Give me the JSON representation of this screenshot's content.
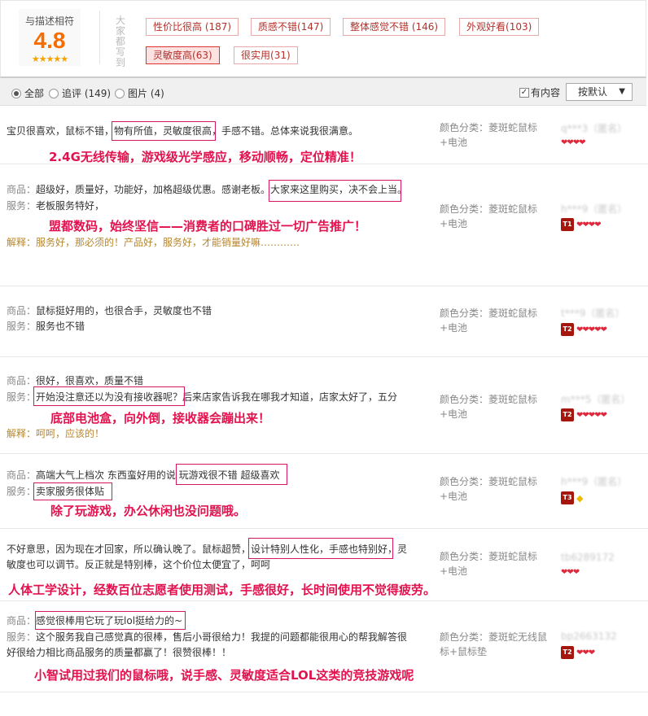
{
  "summary": {
    "score_title": "与描述相符",
    "score": "4.8",
    "stars": "★★★★★",
    "everyone_says": "大家都写到",
    "tags": [
      {
        "label": "性价比很高",
        "count": "(187)"
      },
      {
        "label": "质感不错",
        "count": "(147)"
      },
      {
        "label": "整体感觉不错",
        "count": "(146)"
      },
      {
        "label": "外观好看",
        "count": "(103)"
      },
      {
        "label": "灵敏度高",
        "count": "(63)"
      },
      {
        "label": "很实用",
        "count": "(31)"
      }
    ]
  },
  "filter": {
    "all": "全部",
    "append": "追评 (149)",
    "pics": "图片 (4)",
    "has_content": "有内容",
    "sort": "按默认",
    "caret": "▼"
  },
  "sku_label": "颜色分类：",
  "reviews": [
    {
      "content": "宝贝很喜欢，鼠标不错，物有所值，灵敏度很高，手感不错。总体来说我很满意。",
      "promo": "2.4G无线传输，游戏级光学感应，移动顺畅，定位精准！",
      "sku1": "菱斑蛇鼠标",
      "sku2": "+电池",
      "user": "q***3（匿名）",
      "level": "",
      "hearts": "❤❤❤❤"
    },
    {
      "c_label": "商品：",
      "content": "超级好，质量好，功能好，加格超级优惠。感谢老板。大家来这里购买，决不会上当。",
      "s_label": "服务：",
      "service": "老板服务特好，",
      "promo": "盟都数码，始终坚信——消费者的口碑胜过一切广告推广！",
      "e_label": "解释：",
      "explain": "服务好，那必须的！产品好，服务好，才能销量好嘛…………",
      "sku1": "菱斑蛇鼠标",
      "sku2": "+电池",
      "user": "h***9（匿名）",
      "level": "T1",
      "hearts": "❤❤❤❤"
    },
    {
      "c_label": "商品：",
      "content": "鼠标挺好用的，也很合手，灵敏度也不错",
      "s_label": "服务：",
      "service": "服务也不错",
      "sku1": "菱斑蛇鼠标",
      "sku2": "+电池",
      "user": "t***9（匿名）",
      "level": "T2",
      "hearts": "❤❤❤❤❤"
    },
    {
      "c_label": "商品：",
      "content": "很好，很喜欢，质量不错",
      "s_label": "服务：",
      "service": "开始没注意还以为没有接收器呢？后来店家告诉我在哪我才知道，店家太好了，五分",
      "promo": "底部电池盒，向外倒，接收器会蹦出来！",
      "e_label": "解释：",
      "explain": "呵呵，应该的！",
      "sku1": "菱斑蛇鼠标",
      "sku2": "+电池",
      "user": "m***5（匿名）",
      "level": "T2",
      "hearts": "❤❤❤❤❤"
    },
    {
      "c_label": "商品：",
      "content": "高端大气上档次 东西蛮好用的说 玩游戏很不错 超级喜欢",
      "s_label": "服务：",
      "service": "卖家服务很体贴",
      "promo": "除了玩游戏，办公休闲也没问题哦。",
      "sku1": "菱斑蛇鼠标",
      "sku2": "+电池",
      "user": "h***9（匿名）",
      "level": "T3",
      "hearts": "◆"
    },
    {
      "content1": "不好意思，因为现在才回家，所以确认晚了。鼠标超赞，设计特别人性化，手感也特别好，灵",
      "content2": "敏度也可以调节。反正就是特别棒，这个价位太便宜了，呵呵",
      "promo": "人体工学设计，经数百位志愿者使用测试，手感很好，长时间使用不觉得疲劳。",
      "sku1": "菱斑蛇鼠标",
      "sku2": "+电池",
      "user": "tb6289172",
      "level": "",
      "hearts": "❤❤❤"
    },
    {
      "c_label": "商品：",
      "content": "感觉很棒用它玩了玩lol挺给力的~",
      "s_label": "服务：",
      "service1": "这个服务我自己感觉真的很棒，售后小哥很给力！我提的问题都能很用心的帮我解答很",
      "service2": "好很给力相比商品服务的质量都赢了！很赞很棒！！",
      "promo": "小智试用过我们的鼠标哦，说手感、灵敏度适合LOL这类的竞技游戏呢",
      "sku1": "菱斑蛇无线鼠",
      "sku2": "标+鼠标垫",
      "user": "bp2663132",
      "level": "T2",
      "hearts": "❤❤❤"
    }
  ]
}
